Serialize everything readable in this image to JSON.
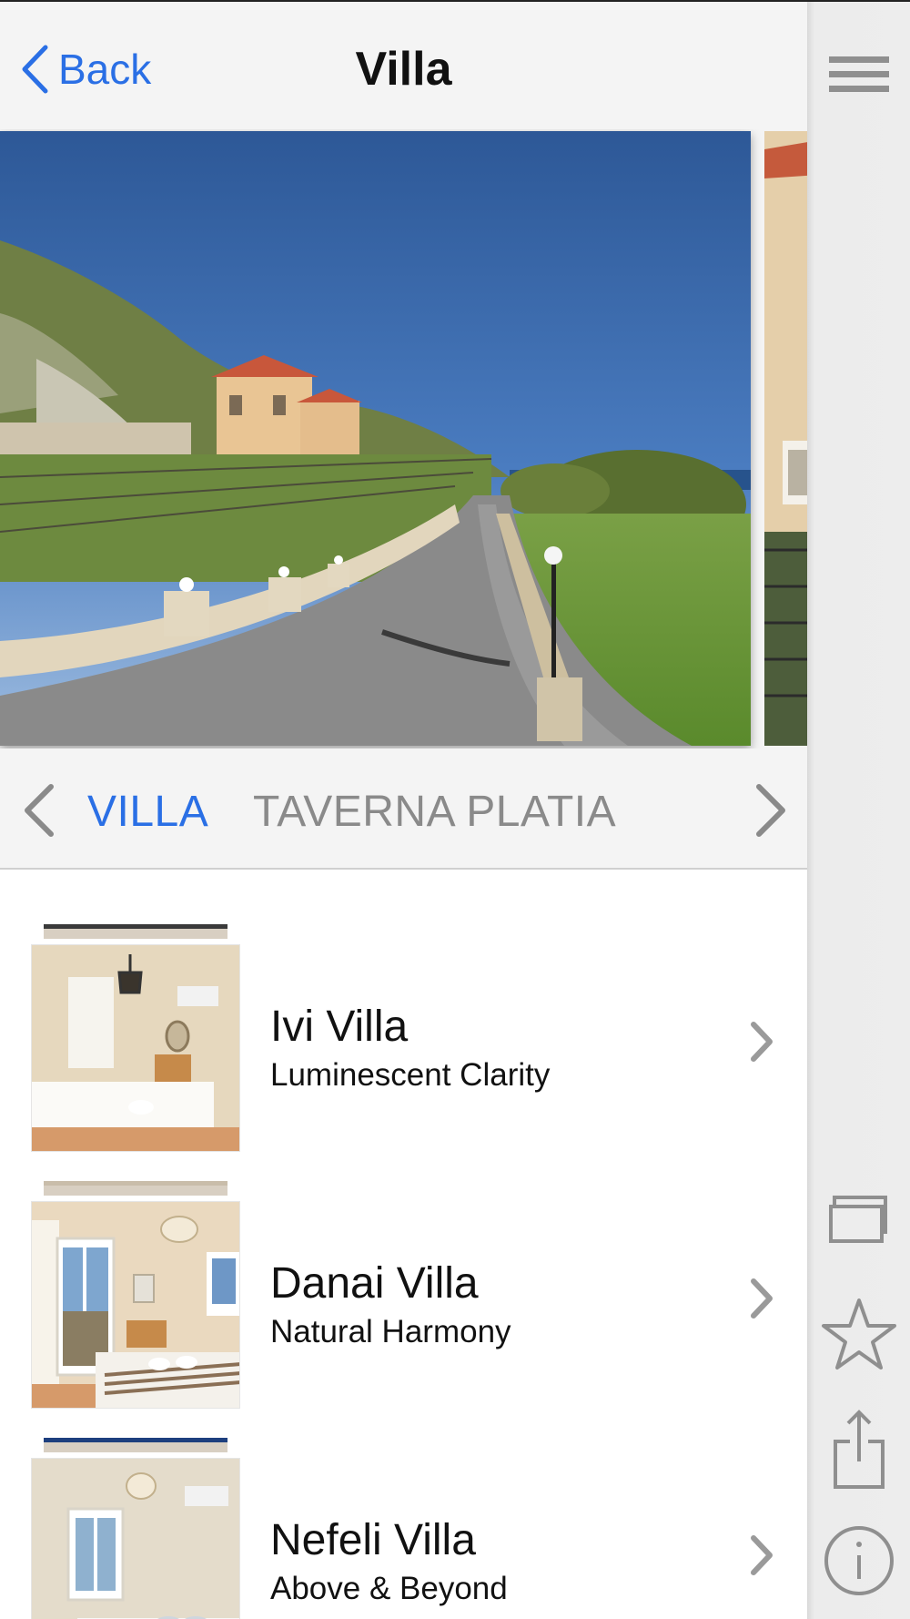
{
  "navbar": {
    "back_label": "Back",
    "title": "Villa"
  },
  "gallery": {
    "photo_count_visible": 2
  },
  "categories": {
    "active": "VILLA",
    "inactive": "TAVERNA PLATIA"
  },
  "villas": [
    {
      "name": "Ivi Villa",
      "tagline": "Luminescent Clarity"
    },
    {
      "name": "Danai Villa",
      "tagline": "Natural Harmony"
    },
    {
      "name": "Nefeli Villa",
      "tagline": "Above & Beyond"
    }
  ],
  "sidebar": {
    "icons": [
      "menu-icon",
      "gallery-icon",
      "star-icon",
      "share-icon",
      "info-icon"
    ]
  },
  "colors": {
    "accent": "#2a6fe5",
    "inactive_text": "#8a8a8a",
    "bar_background": "#f4f4f4"
  }
}
